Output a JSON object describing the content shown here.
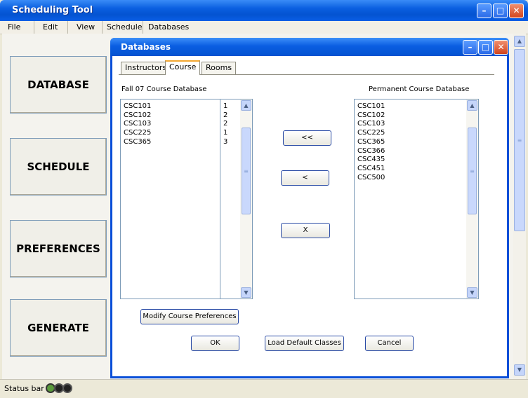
{
  "window": {
    "title": "Scheduling Tool",
    "min": "–",
    "max": "□",
    "close": "✕"
  },
  "menu": [
    "File",
    "Edit",
    "View",
    "Schedule",
    "Databases"
  ],
  "sidebar": [
    "DATABASE",
    "SCHEDULE",
    "PREFERENCES",
    "GENERATE"
  ],
  "status": {
    "text": "Status bar",
    "lights": [
      true,
      false,
      false
    ]
  },
  "dialog": {
    "title": "Databases",
    "min": "–",
    "max": "□",
    "close": "✕",
    "tabs": [
      "Instructors",
      "Course",
      "Rooms"
    ],
    "active_tab": "Course",
    "left_title": "Fall 07 Course Database",
    "right_title": "Permanent Course Database",
    "left_courses": [
      "CSC101",
      "CSC102",
      "CSC103",
      "CSC225",
      "CSC365"
    ],
    "left_values": [
      "1",
      "2",
      "2",
      "1",
      "3"
    ],
    "right_courses": [
      "CSC101",
      "CSC102",
      "CSC103",
      "CSC225",
      "CSC365",
      "CSC366",
      "CSC435",
      "CSC451",
      "CSC500"
    ],
    "buttons": {
      "move_all": "<<",
      "move_one": "<",
      "remove": "X",
      "modify": "Modify Course Preferences",
      "ok": "OK",
      "load_default": "Load Default Classes",
      "cancel": "Cancel"
    }
  },
  "icons": {
    "scroll_up": "▲",
    "scroll_down": "▼",
    "grip": "≡"
  }
}
